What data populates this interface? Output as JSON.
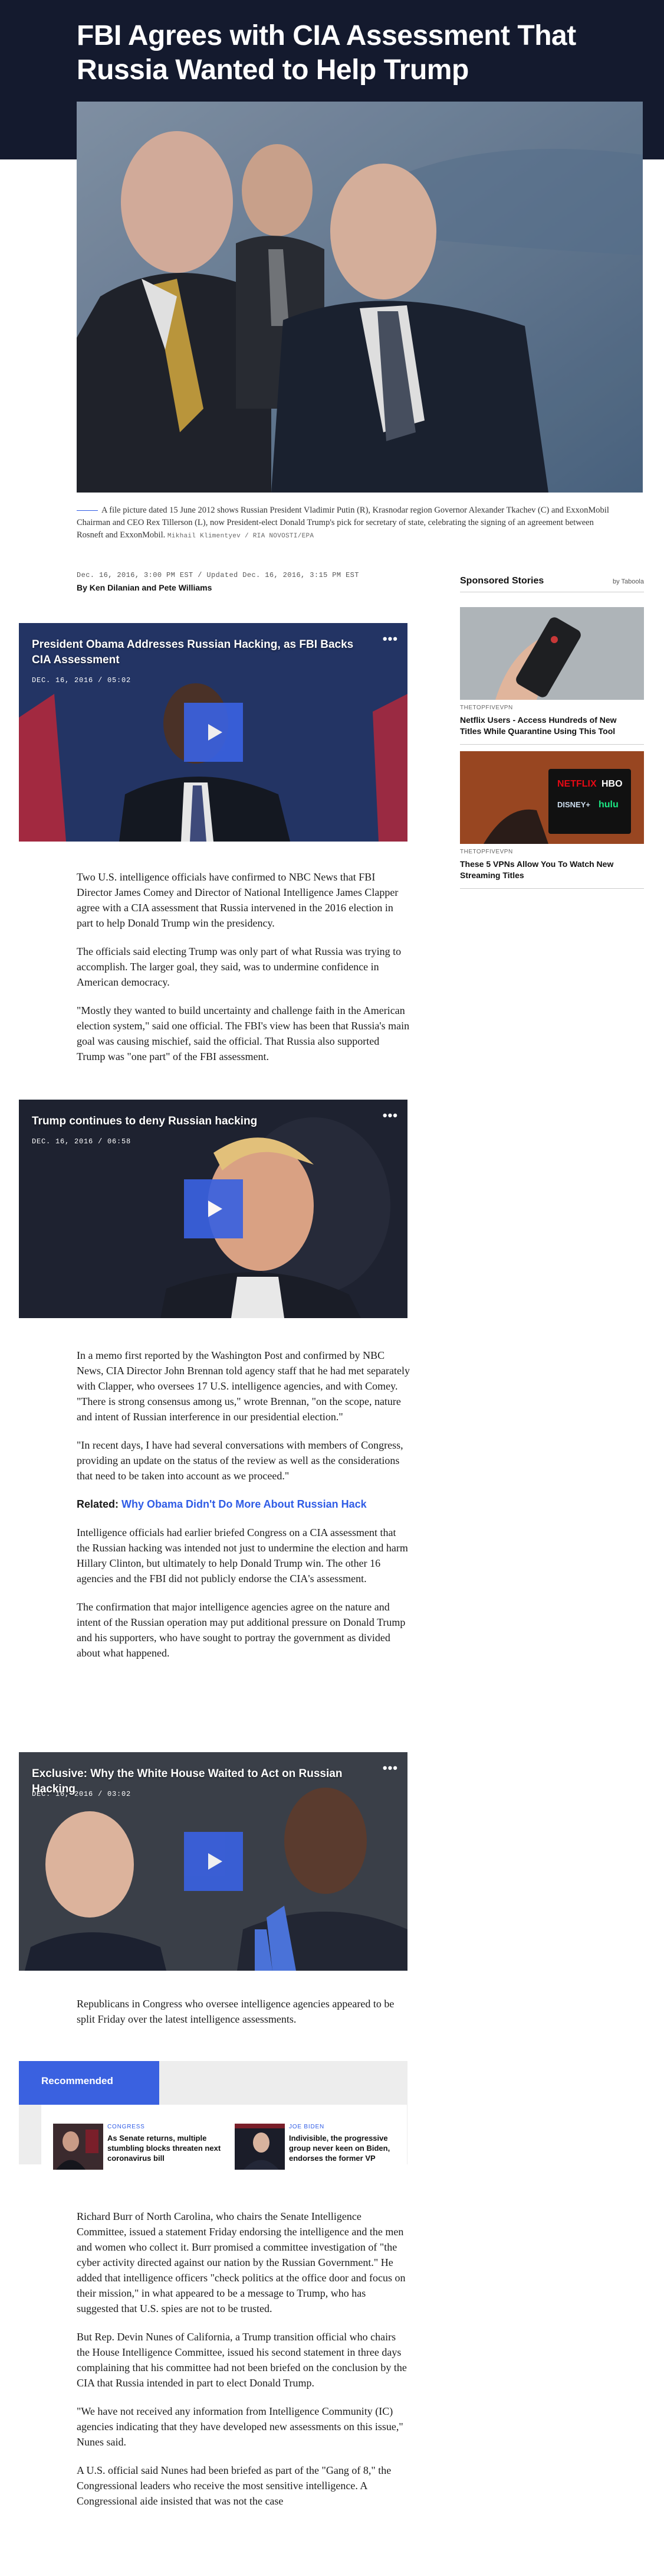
{
  "article": {
    "headline": "FBI Agrees with CIA Assessment That Russia Wanted to Help Trump",
    "caption": "A file picture dated 15 June 2012 shows Russian President Vladimir Putin (R), Krasnodar region Governor Alexander Tkachev (C) and ExxonMobil Chairman and CEO Rex Tillerson (L), now President-elect Donald Trump's pick for secretary of state, celebrating the signing of an agreement between Rosneft and ExxonMobil.",
    "photo_credit": "Mikhail Klimentyev / RIA NOVOSTI/EPA",
    "dateline": "Dec. 16, 2016, 3:00 PM EST / Updated Dec. 16, 2016, 3:15 PM EST",
    "byline": "By Ken Dilanian and Pete Williams",
    "paragraphs_1": [
      "Two U.S. intelligence officials have confirmed to NBC News that FBI Director James Comey and Director of National Intelligence James Clapper agree with a CIA assessment that Russia intervened in the 2016 election in part to help Donald Trump win the presidency.",
      "The officials said electing Trump was only part of what Russia was trying to accomplish. The larger goal, they said, was to undermine confidence in American democracy.",
      "\"Mostly they wanted to build uncertainty and challenge faith in the American election system,\" said one official. The FBI's view has been that Russia's main goal was causing mischief, said the official. That Russia also supported Trump was \"one part\" of the FBI assessment."
    ],
    "paragraphs_2": [
      "In a memo first reported by the Washington Post and confirmed by NBC News, CIA Director John Brennan told agency staff that he had met separately with Clapper, who oversees 17 U.S. intelligence agencies, and with Comey. \"There is strong consensus among us,\" wrote Brennan, \"on the scope, nature and intent of Russian interference in our presidential election.\"",
      "\"In recent days, I have had several conversations with members of Congress, providing an update on the status of the review as well as the considerations that need to be taken into account as we proceed.\""
    ],
    "related_label": "Related:",
    "related_link": "Why Obama Didn't Do More About Russian Hack",
    "paragraphs_3": [
      "Intelligence officials had earlier briefed Congress on a CIA assessment that the Russian hacking was intended not just to undermine the election and harm Hillary Clinton, but ultimately to help Donald Trump win. The other 16 agencies and the FBI did not publicly endorse the CIA's assessment.",
      "The confirmation that major intelligence agencies agree on the nature and intent of the Russian operation may put additional pressure on Donald Trump and his supporters, who have sought to portray the government as divided about what happened."
    ],
    "paragraphs_4": [
      "Republicans in Congress who oversee intelligence agencies appeared to be split Friday over the latest intelligence assessments."
    ],
    "paragraphs_5": [
      "Richard Burr of North Carolina, who chairs the Senate Intelligence Committee, issued a statement Friday endorsing the intelligence and the men and women who collect it. Burr promised a committee investigation of \"the cyber activity directed against our nation by the Russian Government.\" He added that intelligence officers \"check politics at the office door and focus on their mission,\" in what appeared to be a message to Trump, who has suggested that U.S. spies are not to be trusted.",
      "But Rep. Devin Nunes of California, a Trump transition official who chairs the House Intelligence Committee, issued his second statement in three days complaining that his committee had not been briefed on the conclusion by the CIA that Russia intended in part to elect Donald Trump.",
      "\"We have not received any information from Intelligence Community (IC) agencies indicating that they have developed new assessments on this issue,\" Nunes said.",
      "A U.S. official said Nunes had been briefed as part of the \"Gang of 8,\" the Congressional leaders who receive the most sensitive intelligence. A Congressional aide insisted that was not the case"
    ]
  },
  "videos": [
    {
      "title": "President Obama Addresses Russian Hacking, as FBI Backs CIA Assessment",
      "date": "DEC. 16, 2016 / 05:02",
      "more": "•••"
    },
    {
      "title": "Trump continues to deny Russian hacking",
      "date": "DEC. 16, 2016 / 06:58",
      "more": "•••"
    },
    {
      "title": "Exclusive: Why the White House Waited to Act on Russian Hacking",
      "date": "DEC. 16, 2016 / 03:02",
      "more": "•••"
    }
  ],
  "sidebar": {
    "heading": "Sponsored Stories",
    "by": "by Taboola",
    "stories": [
      {
        "source": "THETOPFIVEVPN",
        "title": "Netflix Users - Access Hundreds of New Titles While Quarantine Using This Tool"
      },
      {
        "source": "THETOPFIVEVPN",
        "title": "These 5 VPNs Allow You To Watch New Streaming Titles"
      }
    ],
    "logos": [
      "NETFLIX",
      "HBO",
      "DISNEY+",
      "hulu"
    ]
  },
  "recommended": {
    "label": "Recommended",
    "items": [
      {
        "category": "Congress",
        "title": "As Senate returns, multiple stumbling blocks threaten next coronavirus bill"
      },
      {
        "category": "Joe Biden",
        "title": "Indivisible, the progressive group never keen on Biden, endorses the former VP"
      }
    ]
  },
  "colors": {
    "header_band": "#141a2e",
    "accent_blue": "#3a61e0",
    "link_blue": "#2f5ce6"
  }
}
